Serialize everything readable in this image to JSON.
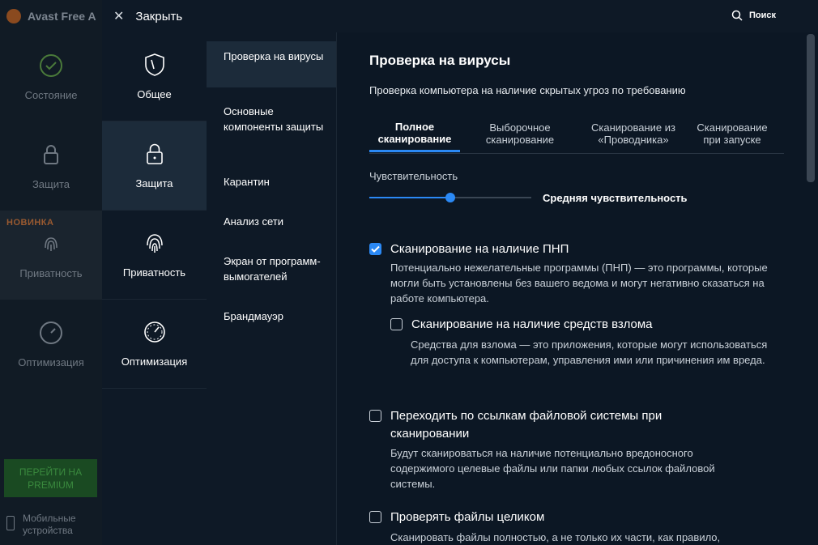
{
  "background_app": {
    "title": "Avast Free A",
    "nav": [
      {
        "label": "Состояние"
      },
      {
        "label": "Защита"
      },
      {
        "label": "Приватность",
        "badge": "НОВИНКА"
      },
      {
        "label": "Оптимизация"
      }
    ],
    "premium_button": "ПЕРЕЙТИ НА PREMIUM",
    "mobile_label": "Мобильные устройства"
  },
  "topbar": {
    "close_label": "Закрыть",
    "search_label": "Поиск"
  },
  "categories": [
    {
      "label": "Общее",
      "icon": "shield-icon",
      "active": false
    },
    {
      "label": "Защита",
      "icon": "lock-icon",
      "active": true
    },
    {
      "label": "Приватность",
      "icon": "fingerprint-icon",
      "active": false
    },
    {
      "label": "Оптимизация",
      "icon": "speedometer-icon",
      "active": false
    }
  ],
  "subnav": [
    {
      "label": "Проверка на вирусы",
      "active": true
    },
    {
      "label": "Основные компоненты защиты"
    },
    {
      "label": "Карантин"
    },
    {
      "label": "Анализ сети"
    },
    {
      "label": "Экран от программ-вымогателей"
    },
    {
      "label": "Брандмауэр"
    }
  ],
  "content": {
    "title": "Проверка на вирусы",
    "description": "Проверка компьютера на наличие скрытых угроз по требованию",
    "tabs": [
      {
        "label": "Полное сканирование",
        "active": true
      },
      {
        "label": "Выборочное сканирование"
      },
      {
        "label": "Сканирование из «Проводника»"
      },
      {
        "label": "Сканирование при запуске"
      }
    ],
    "sensitivity": {
      "label": "Чувствительность",
      "value_label": "Средняя чувствительность",
      "level": 0.5
    },
    "options": [
      {
        "title": "Сканирование на наличие ПНП",
        "checked": true,
        "description": "Потенциально нежелательные программы (ПНП) — это программы, которые могли быть установлены без вашего ведома и могут негативно сказаться на работе компьютера."
      },
      {
        "title": "Сканирование на наличие средств взлома",
        "checked": false,
        "description": "Средства для взлома — это приложения, которые могут использоваться для доступа к компьютерам, управления ими или причинения им вреда."
      },
      {
        "title": "Переходить по ссылкам файловой системы при сканировании",
        "checked": false,
        "description": "Будут сканироваться на наличие потенциально вредоносного содержимого целевые файлы или папки любых ссылок файловой системы."
      },
      {
        "title": "Проверять файлы целиком",
        "checked": false,
        "description": "Сканировать файлы полностью, а не только их части, как правило,"
      }
    ]
  },
  "colors": {
    "accent": "#2b89f5",
    "panel": "#0e1926",
    "active": "#1c2b3a"
  }
}
